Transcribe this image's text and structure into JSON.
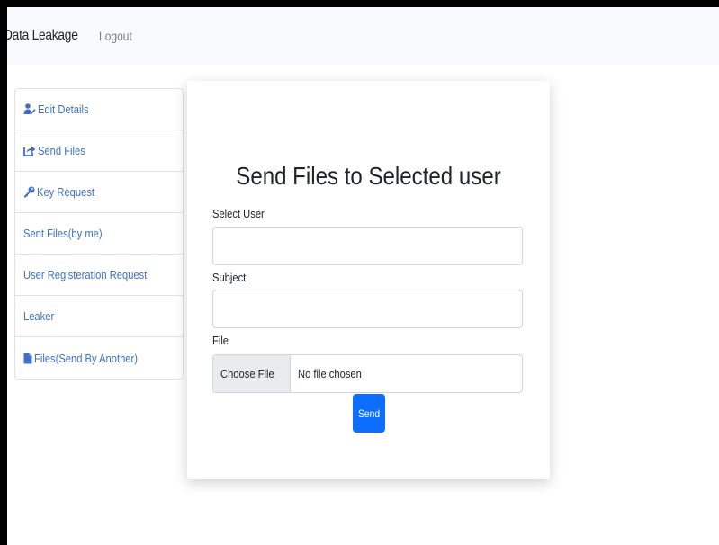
{
  "navbar": {
    "brand": "Data Leakage",
    "logout": "Logout"
  },
  "sidebar": {
    "items": [
      {
        "label": "Edit Details",
        "icon": "user-edit-icon"
      },
      {
        "label": "Send Files",
        "icon": "share-square-icon"
      },
      {
        "label": "Key Request",
        "icon": "key-icon"
      },
      {
        "label": "Sent Files(by me)",
        "icon": null
      },
      {
        "label": "User Registeration Request",
        "icon": null
      },
      {
        "label": "Leaker",
        "icon": null
      },
      {
        "label": "Files(Send By Another)",
        "icon": "file-icon"
      }
    ]
  },
  "form": {
    "title": "Send Files to Selected user",
    "select_user_label": "Select User",
    "select_user_value": "",
    "subject_label": "Subject",
    "subject_value": "",
    "file_label": "File",
    "choose_file_label": "Choose File",
    "file_status": "No file chosen",
    "send_label": "Send"
  },
  "colors": {
    "link": "#3f6fc4",
    "primary": "#0d6efd",
    "navbar_bg": "#f8f9fa"
  }
}
